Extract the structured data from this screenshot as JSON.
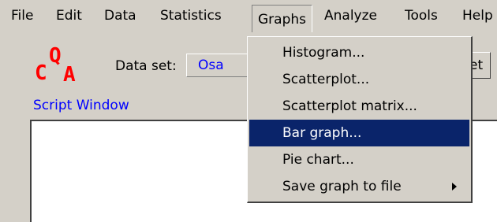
{
  "menubar": {
    "items": [
      {
        "label": "File"
      },
      {
        "label": "Edit"
      },
      {
        "label": "Data"
      },
      {
        "label": "Statistics"
      },
      {
        "label": "Graphs"
      },
      {
        "label": "Analyze"
      },
      {
        "label": "Tools"
      },
      {
        "label": "Help"
      }
    ],
    "active": "Graphs"
  },
  "toolbar": {
    "logo_letters": [
      "C",
      "Q",
      "A"
    ],
    "dataset_label": "Data set:",
    "dataset_value": "Osa",
    "right_button_label": "et"
  },
  "script_window": {
    "label": "Script Window"
  },
  "graphs_menu": {
    "items": [
      {
        "label": "Histogram..."
      },
      {
        "label": "Scatterplot..."
      },
      {
        "label": "Scatterplot matrix..."
      },
      {
        "label": "Bar graph..."
      },
      {
        "label": "Pie chart..."
      },
      {
        "label": "Save graph to file"
      }
    ],
    "highlighted": "Bar graph..."
  },
  "colors": {
    "highlight": "#0a246a",
    "logo": "#ff0000",
    "link": "#0000ff",
    "face": "#d4d0c8"
  }
}
